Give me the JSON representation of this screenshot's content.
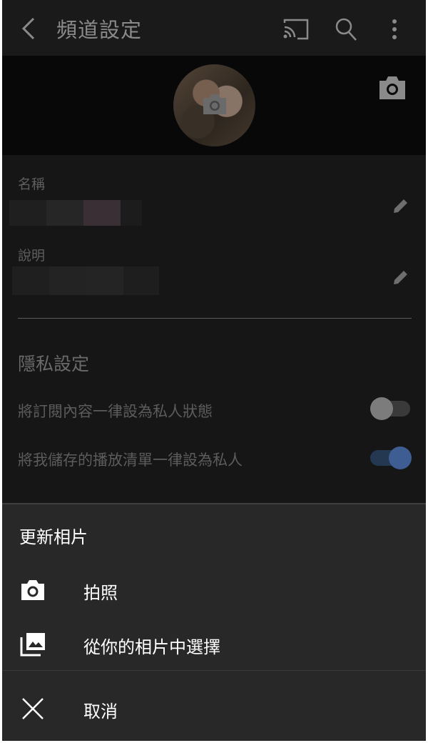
{
  "appbar": {
    "title": "頻道設定",
    "icons": [
      "back-arrow-icon",
      "cast-icon",
      "search-icon",
      "more-vert-icon"
    ]
  },
  "banner": {
    "icons": [
      "camera-icon"
    ]
  },
  "fields": {
    "name_label": "名稱",
    "description_label": "說明"
  },
  "privacy": {
    "title": "隱私設定",
    "toggle_subscriptions": {
      "label": "將訂閱內容一律設為私人狀態",
      "on": false
    },
    "toggle_playlists": {
      "label": "將我儲存的播放清單一律設為私人",
      "on": true
    }
  },
  "sheet": {
    "heading": "更新相片",
    "take_photo": "拍照",
    "choose_photo": "從你的相片中選擇",
    "cancel": "取消"
  },
  "colors": {
    "accent_blue": "#3e5e93",
    "toggle_off_knob": "#7c7c7c"
  }
}
